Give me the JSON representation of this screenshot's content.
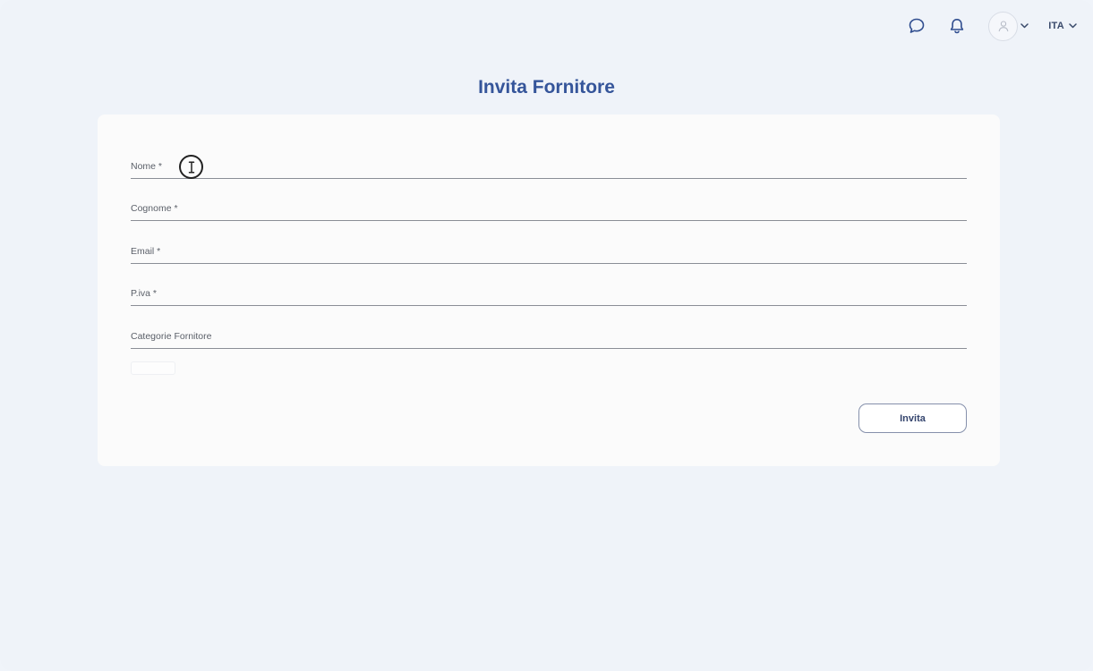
{
  "header": {
    "icons": [
      "chat-bubble-icon",
      "bell-icon",
      "user-icon",
      "chevron-down-icon"
    ],
    "language": "ITA"
  },
  "page": {
    "title": "Invita Fornitore"
  },
  "form": {
    "fields": [
      {
        "label": "Nome *",
        "value": ""
      },
      {
        "label": "Cognome *",
        "value": ""
      },
      {
        "label": "Email *",
        "value": ""
      },
      {
        "label": "P.iva *",
        "value": ""
      },
      {
        "label": "Categorie Fornitore",
        "value": ""
      }
    ],
    "submit_label": "Invita"
  },
  "colors": {
    "background": "#eff3f9",
    "title": "#35559a",
    "card": "#fbfbfb",
    "button_border": "#8590ab"
  }
}
